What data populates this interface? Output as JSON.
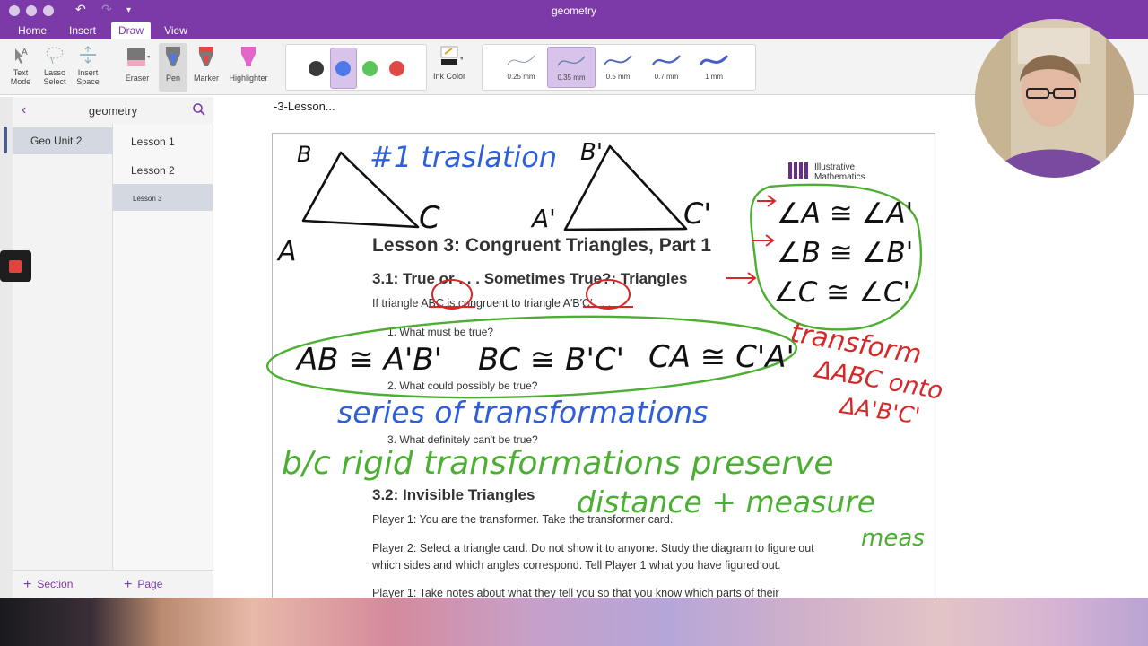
{
  "window": {
    "title": "geometry"
  },
  "tabs": [
    {
      "label": "Home",
      "active": false
    },
    {
      "label": "Insert",
      "active": false
    },
    {
      "label": "Draw",
      "active": true
    },
    {
      "label": "View",
      "active": false
    }
  ],
  "ribbon": {
    "text_mode": [
      "Text",
      "Mode"
    ],
    "lasso_select": [
      "Lasso",
      "Select"
    ],
    "insert_space": [
      "Insert",
      "Space"
    ],
    "eraser": "Eraser",
    "pen": "Pen",
    "marker": "Marker",
    "highlighter": "Highlighter",
    "ink_color": "Ink Color",
    "colors": [
      "#3a3a3a",
      "#4f78e8",
      "#5cc45c",
      "#e04848"
    ],
    "selected_color": "#4f78e8",
    "thicknesses": [
      "0.25 mm",
      "0.35 mm",
      "0.5 mm",
      "0.7 mm",
      "1 mm"
    ],
    "selected_thickness": "0.35 mm"
  },
  "nav": {
    "notebook_title": "geometry",
    "sections": [
      {
        "label": "Geo Unit 2",
        "selected": true
      }
    ],
    "pages": [
      {
        "label": "Lesson 1",
        "selected": false
      },
      {
        "label": "Lesson 2",
        "selected": false
      },
      {
        "label": "Lesson 3",
        "selected": true
      }
    ],
    "add_section": "Section",
    "add_page": "Page"
  },
  "page": {
    "title": "-3-Lesson...",
    "logo": {
      "line1": "Illustrative",
      "line2": "Mathematics"
    },
    "lesson_title": "Lesson 3: Congruent Triangles, Part 1",
    "section1_title": "3.1: True or . . . Sometimes True?: Triangles",
    "prompt": "If triangle ABC is congruent to triangle A′B′C′ . . .",
    "questions": [
      "1. What must be true?",
      "2. What could possibly be true?",
      "3. What definitely can't be true?"
    ],
    "section2_title": "3.2: Invisible Triangles",
    "player1": "Player 1: You are the transformer. Take the transformer card.",
    "player2_line1": "Player 2: Select a triangle card. Do not show it to anyone. Study the diagram to figure out",
    "player2_line2": "which sides and which angles correspond. Tell Player 1 what you have figured out.",
    "player1b": "Player 1: Take notes about what they tell you so that you know which parts of their"
  },
  "ink": {
    "tri1_labels": [
      "B",
      "A",
      "C"
    ],
    "tri2_labels": [
      "B'",
      "A'",
      "C'"
    ],
    "blue_translation": "#1 traslation",
    "blue_series": "series of transformations",
    "green_sides": [
      "AB ≅ A'B'",
      "BC ≅ B'C'",
      "CA ≅ C'A'"
    ],
    "green_angles": [
      "∠A ≅ ∠A'",
      "∠B ≅ ∠B'",
      "∠C ≅ ∠C'"
    ],
    "green_because": "b/c rigid transformations preserve",
    "green_distance": "distance + measure",
    "green_meas": "meas",
    "red_note": [
      "transform",
      "ΔABC onto",
      "ΔA'B'C'"
    ],
    "ink_colors": {
      "blue": "#2f5fd8",
      "green": "#4caf32",
      "red": "#d62828",
      "black": "#111111"
    }
  }
}
